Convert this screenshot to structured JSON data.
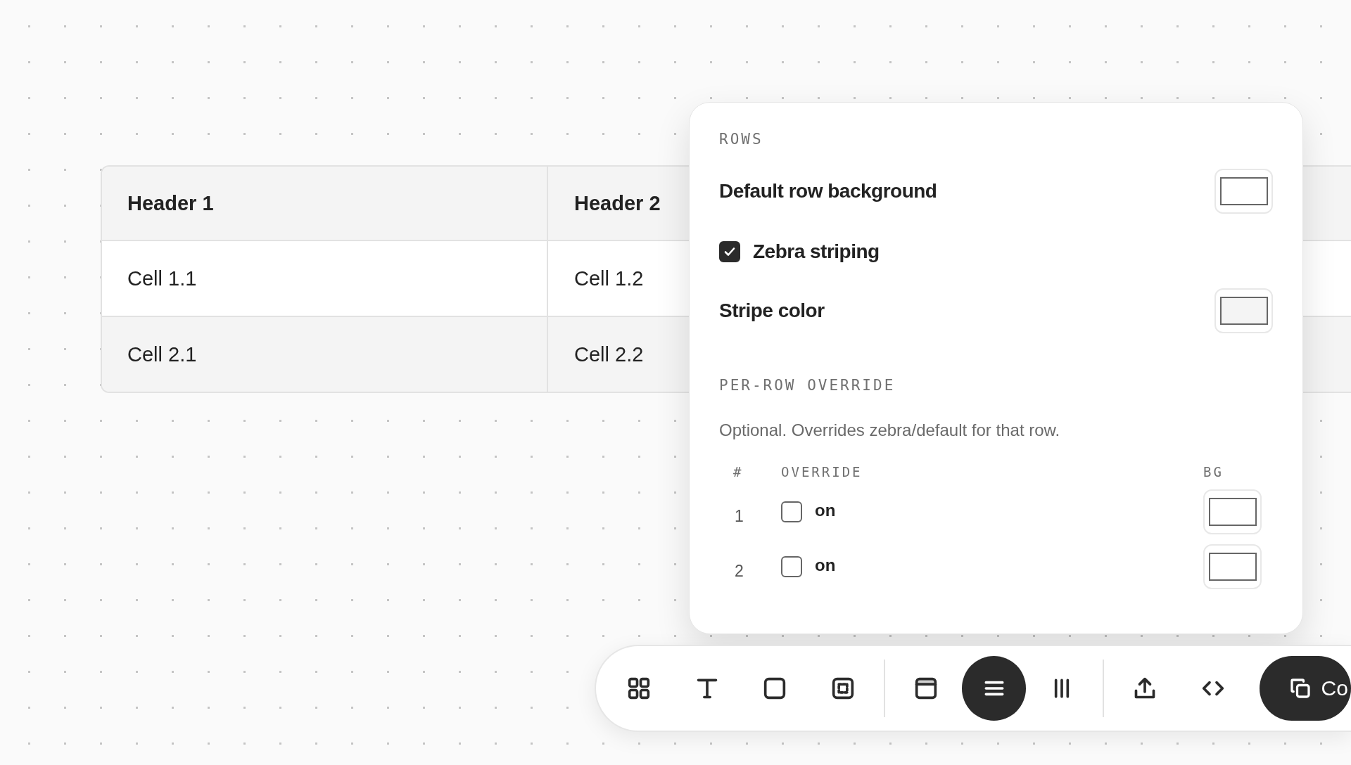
{
  "table": {
    "columns": [
      "Header 1",
      "Header 2"
    ],
    "rows": [
      [
        "Cell 1.1",
        "Cell 1.2"
      ],
      [
        "Cell 2.1",
        "Cell 2.2"
      ]
    ]
  },
  "panel": {
    "rows_heading": "ROWS",
    "default_background": {
      "label": "Default row background",
      "color": "#ffffff"
    },
    "zebra": {
      "label": "Zebra striping",
      "checked": true
    },
    "stripe": {
      "label": "Stripe color",
      "color": "#f4f4f4"
    },
    "override_heading": "PER-ROW OVERRIDE",
    "hint": "Optional. Overrides zebra/default for that row.",
    "columns": [
      "#",
      "OVERRIDE",
      "BG"
    ],
    "overrides": [
      {
        "number": "1",
        "label": "on",
        "checked": false,
        "color": "#ffffff"
      },
      {
        "number": "2",
        "label": "on",
        "checked": false,
        "color": "#ffffff"
      }
    ]
  },
  "toolbar": {
    "groups": [
      [
        {
          "kind": "grid",
          "selected": false
        },
        {
          "kind": "text",
          "selected": false
        },
        {
          "kind": "square",
          "selected": false
        },
        {
          "kind": "frame",
          "selected": false
        }
      ],
      [
        {
          "kind": "header",
          "selected": false
        },
        {
          "kind": "rows",
          "selected": true
        },
        {
          "kind": "columns",
          "selected": false
        }
      ],
      [
        {
          "kind": "export",
          "selected": false
        },
        {
          "kind": "code",
          "selected": false
        }
      ]
    ],
    "copy_label": "Co"
  }
}
